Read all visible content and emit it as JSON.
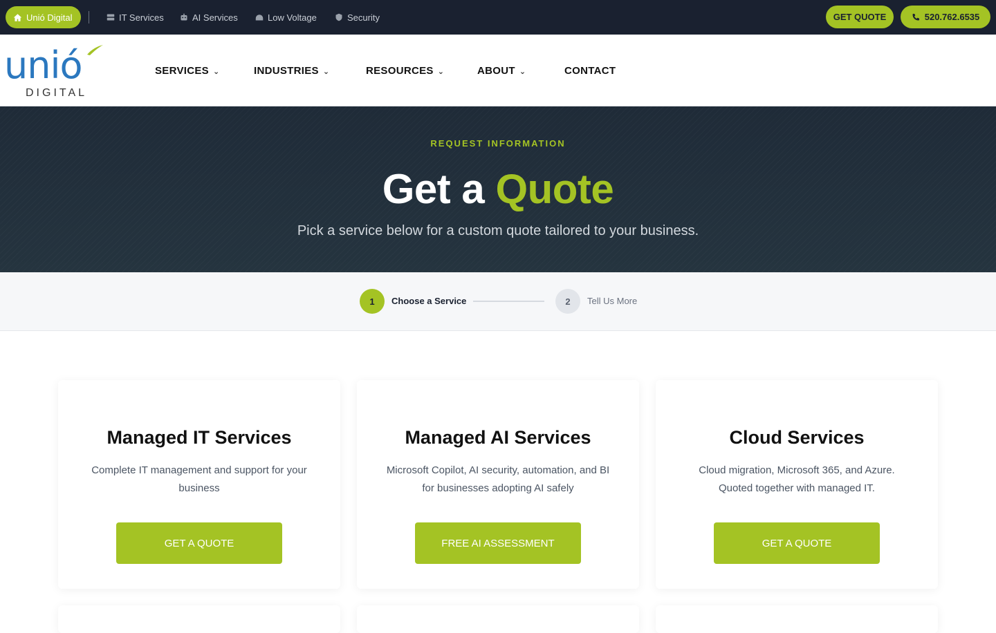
{
  "topbar": {
    "home_label": "Unió Digital",
    "links": [
      {
        "label": "IT Services",
        "icon": "server-icon"
      },
      {
        "label": "AI Services",
        "icon": "robot-icon"
      },
      {
        "label": "Low Voltage",
        "icon": "network-icon"
      },
      {
        "label": "Security",
        "icon": "shield-icon"
      }
    ],
    "quote_label": "GET QUOTE",
    "phone": "520.762.6535"
  },
  "logo": {
    "word": "unió",
    "sub": "DIGITAL"
  },
  "nav": {
    "items": [
      {
        "label": "SERVICES",
        "dropdown": true
      },
      {
        "label": "INDUSTRIES",
        "dropdown": true
      },
      {
        "label": "RESOURCES",
        "dropdown": true
      },
      {
        "label": "ABOUT",
        "dropdown": true
      },
      {
        "label": "CONTACT",
        "dropdown": false
      }
    ]
  },
  "hero": {
    "eyebrow": "REQUEST INFORMATION",
    "title_main": "Get a",
    "title_accent": "Quote",
    "subtitle": "Pick a service below for a custom quote tailored to your business."
  },
  "steps": [
    {
      "number": "1",
      "label": "Choose a Service",
      "active": true
    },
    {
      "number": "2",
      "label": "Tell Us More",
      "active": false
    }
  ],
  "cards": [
    {
      "title": "Managed IT Services",
      "desc": "Complete IT management and support for your business",
      "button": "GET A QUOTE"
    },
    {
      "title": "Managed AI Services",
      "desc": "Microsoft Copilot, AI security, automation, and BI for businesses adopting AI safely",
      "button": "FREE AI ASSESSMENT"
    },
    {
      "title": "Cloud Services",
      "desc": "Cloud migration, Microsoft 365, and Azure. Quoted together with managed IT.",
      "button": "GET A QUOTE"
    }
  ],
  "colors": {
    "brand_green": "#a4c324",
    "dark_navy": "#1a2130",
    "logo_blue": "#2b78bf"
  }
}
